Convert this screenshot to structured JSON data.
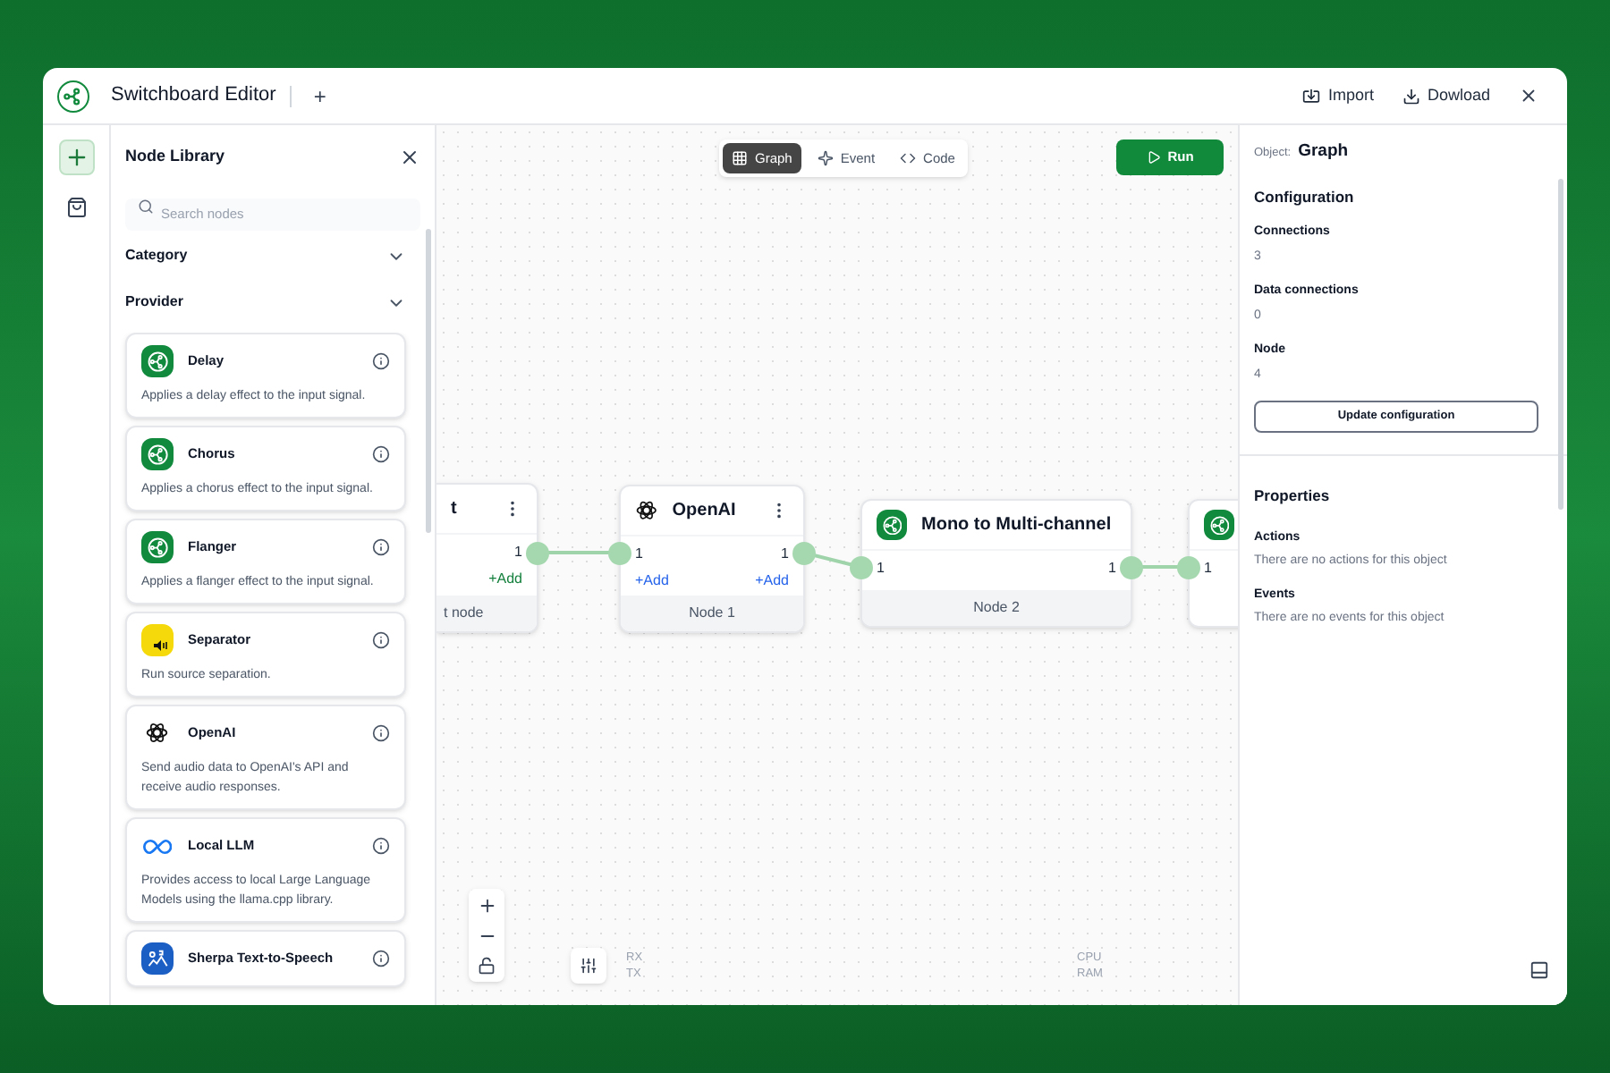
{
  "window": {
    "title": "Switchboard Editor",
    "new_tab": "+",
    "actions": [
      {
        "label": "Import",
        "kind": "import"
      },
      {
        "label": "Dowload",
        "kind": "download"
      }
    ]
  },
  "rail": [
    {
      "kind": "add",
      "selected": true
    },
    {
      "kind": "bag",
      "selected": false
    }
  ],
  "library": {
    "title": "Node Library",
    "search": {
      "placeholder": "Search nodes"
    },
    "filters": [
      {
        "label": "Category",
        "expanded": false
      },
      {
        "label": "Provider",
        "expanded": false
      }
    ],
    "items": [
      {
        "name": "Delay",
        "kind": "effect",
        "description": "Applies a delay effect to the input signal."
      },
      {
        "name": "Chorus",
        "kind": "effect",
        "description": "Applies a chorus effect to the input signal."
      },
      {
        "name": "Flanger",
        "kind": "effect",
        "description": "Applies a flanger effect to the input signal."
      },
      {
        "name": "Separator",
        "kind": "separator",
        "description": "Run source separation."
      },
      {
        "name": "OpenAI",
        "kind": "openai",
        "description": "Send audio data to OpenAI's API and receive audio responses."
      },
      {
        "name": "Local LLM",
        "kind": "llm",
        "description": "Provides access to local Large Language Models using the llama.cpp library."
      },
      {
        "name": "Sherpa Text-to-Speech",
        "kind": "tts"
      }
    ]
  },
  "canvas": {
    "tabs": [
      {
        "label": "Graph",
        "kind": "grid",
        "selected": true
      },
      {
        "label": "Event",
        "kind": "sparkle",
        "selected": false
      },
      {
        "label": "Code",
        "kind": "code",
        "selected": false
      }
    ],
    "run_button": "Run",
    "nodes": [
      {
        "title": "t",
        "kind": "none",
        "output": "1",
        "add_output": "+Add",
        "footer": "t node"
      },
      {
        "title": "OpenAI",
        "kind": "openai",
        "input": "1",
        "output": "1",
        "add_input": "+Add",
        "add_output": "+Add",
        "footer": "Node 1"
      },
      {
        "title": "Mono to Multi-channel",
        "kind": "effect",
        "input": "1",
        "output": "1",
        "footer": "Node 2"
      },
      {
        "kind": "effect",
        "input": "1"
      }
    ],
    "stats": {
      "network": [
        "RX",
        "TX"
      ],
      "system": [
        "CPU",
        "RAM"
      ]
    }
  },
  "inspector": {
    "object_label": "Object:",
    "object": "Graph",
    "configuration": {
      "title": "Configuration",
      "fields": [
        {
          "label": "Connections",
          "value": "3"
        },
        {
          "label": "Data connections",
          "value": "0"
        },
        {
          "label": "Node",
          "value": "4"
        }
      ],
      "button": "Update configuration"
    },
    "properties": {
      "title": "Properties",
      "sections": [
        {
          "label": "Actions",
          "text": "There are no actions for this object"
        },
        {
          "label": "Events",
          "text": "There are no events for this object"
        }
      ]
    }
  }
}
